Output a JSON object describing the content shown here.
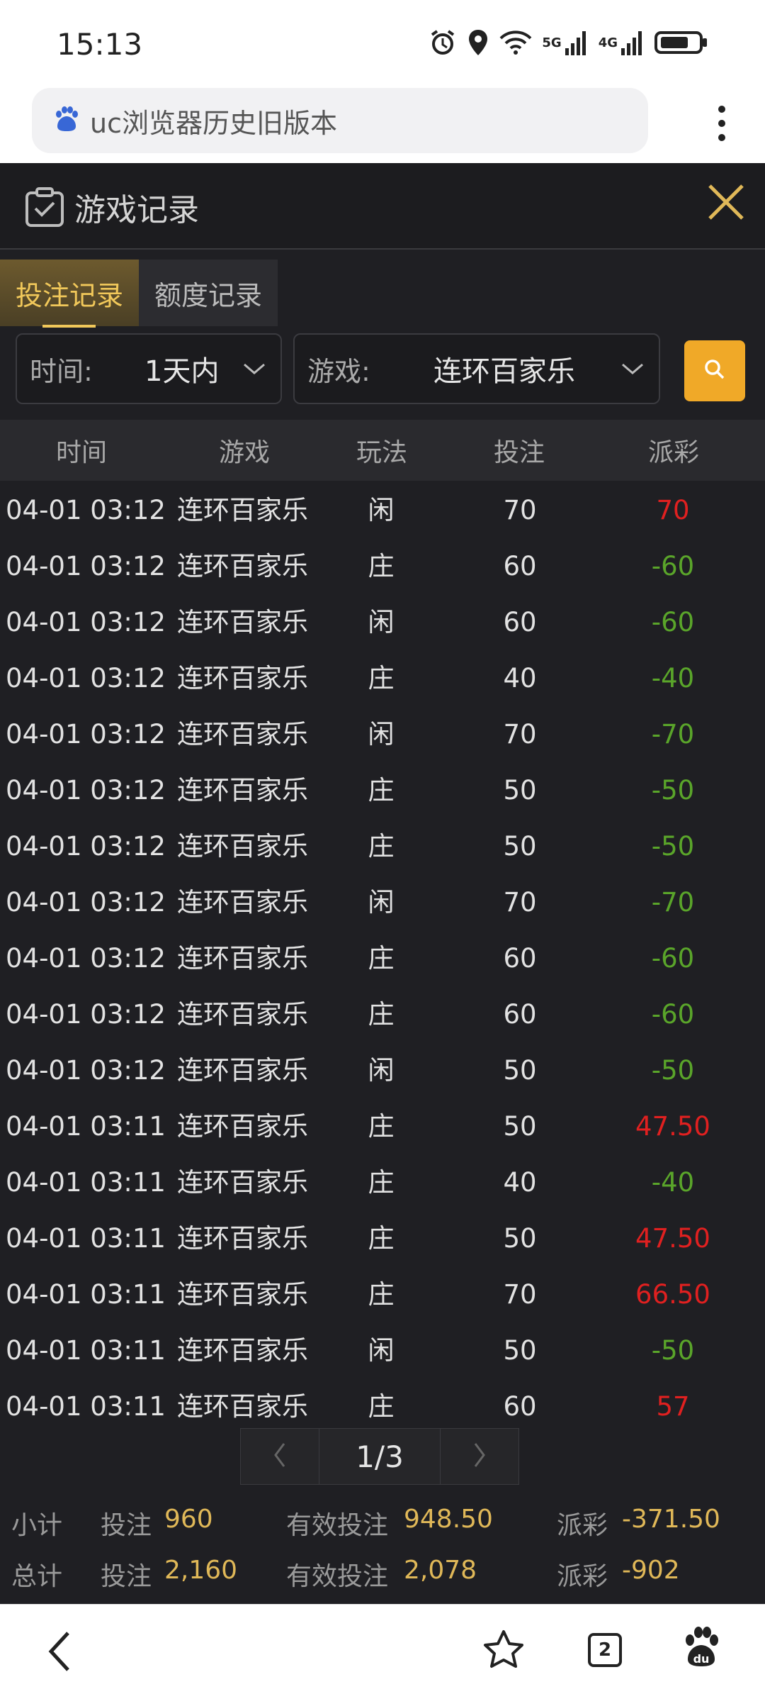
{
  "status": {
    "time": "15:13",
    "network1": "5G",
    "network2": "4G"
  },
  "browser": {
    "url_text": "uc浏览器历史旧版本"
  },
  "panel": {
    "title": "游戏记录",
    "tabs": [
      {
        "label": "投注记录",
        "active": true
      },
      {
        "label": "额度记录",
        "active": false
      }
    ],
    "filters": {
      "time_label": "时间:",
      "time_value": "1天内",
      "game_label": "游戏:",
      "game_value": "连环百家乐"
    },
    "table": {
      "headers": [
        "时间",
        "游戏",
        "玩法",
        "投注",
        "派彩"
      ],
      "rows": [
        {
          "time": "04-01 03:12",
          "game": "连环百家乐",
          "play": "闲",
          "bet": "70",
          "payout": "70",
          "sign": "pos"
        },
        {
          "time": "04-01 03:12",
          "game": "连环百家乐",
          "play": "庄",
          "bet": "60",
          "payout": "-60",
          "sign": "neg"
        },
        {
          "time": "04-01 03:12",
          "game": "连环百家乐",
          "play": "闲",
          "bet": "60",
          "payout": "-60",
          "sign": "neg"
        },
        {
          "time": "04-01 03:12",
          "game": "连环百家乐",
          "play": "庄",
          "bet": "40",
          "payout": "-40",
          "sign": "neg"
        },
        {
          "time": "04-01 03:12",
          "game": "连环百家乐",
          "play": "闲",
          "bet": "70",
          "payout": "-70",
          "sign": "neg"
        },
        {
          "time": "04-01 03:12",
          "game": "连环百家乐",
          "play": "庄",
          "bet": "50",
          "payout": "-50",
          "sign": "neg"
        },
        {
          "time": "04-01 03:12",
          "game": "连环百家乐",
          "play": "庄",
          "bet": "50",
          "payout": "-50",
          "sign": "neg"
        },
        {
          "time": "04-01 03:12",
          "game": "连环百家乐",
          "play": "闲",
          "bet": "70",
          "payout": "-70",
          "sign": "neg"
        },
        {
          "time": "04-01 03:12",
          "game": "连环百家乐",
          "play": "庄",
          "bet": "60",
          "payout": "-60",
          "sign": "neg"
        },
        {
          "time": "04-01 03:12",
          "game": "连环百家乐",
          "play": "庄",
          "bet": "60",
          "payout": "-60",
          "sign": "neg"
        },
        {
          "time": "04-01 03:12",
          "game": "连环百家乐",
          "play": "闲",
          "bet": "50",
          "payout": "-50",
          "sign": "neg"
        },
        {
          "time": "04-01 03:11",
          "game": "连环百家乐",
          "play": "庄",
          "bet": "50",
          "payout": "47.50",
          "sign": "pos"
        },
        {
          "time": "04-01 03:11",
          "game": "连环百家乐",
          "play": "庄",
          "bet": "40",
          "payout": "-40",
          "sign": "neg"
        },
        {
          "time": "04-01 03:11",
          "game": "连环百家乐",
          "play": "庄",
          "bet": "50",
          "payout": "47.50",
          "sign": "pos"
        },
        {
          "time": "04-01 03:11",
          "game": "连环百家乐",
          "play": "庄",
          "bet": "70",
          "payout": "66.50",
          "sign": "pos"
        },
        {
          "time": "04-01 03:11",
          "game": "连环百家乐",
          "play": "闲",
          "bet": "50",
          "payout": "-50",
          "sign": "neg"
        },
        {
          "time": "04-01 03:11",
          "game": "连环百家乐",
          "play": "庄",
          "bet": "60",
          "payout": "57",
          "sign": "pos"
        }
      ]
    },
    "pager": {
      "page_text": "1/3"
    },
    "summary": {
      "subtotal": {
        "label": "小计",
        "bet_label": "投注",
        "bet": "960",
        "valid_label": "有效投注",
        "valid": "948.50",
        "pay_label": "派彩",
        "pay": "-371.50"
      },
      "total": {
        "label": "总计",
        "bet_label": "投注",
        "bet": "2,160",
        "valid_label": "有效投注",
        "valid": "2,078",
        "pay_label": "派彩",
        "pay": "-902"
      }
    }
  },
  "bottom_nav": {
    "tab_count": "2"
  },
  "colors": {
    "accent": "#f0a928",
    "gold_text": "#e0b858",
    "win": "#e02020",
    "loss": "#5aa52a"
  }
}
